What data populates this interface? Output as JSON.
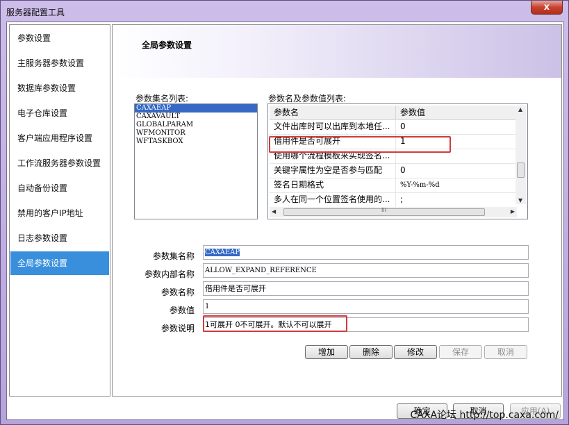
{
  "window": {
    "title": "服务器配置工具",
    "close_symbol": "x"
  },
  "nav": {
    "items": [
      {
        "label": "参数设置"
      },
      {
        "label": "主服务器参数设置"
      },
      {
        "label": "数据库参数设置"
      },
      {
        "label": "电子仓库设置"
      },
      {
        "label": "客户端应用程序设置"
      },
      {
        "label": "工作流服务器参数设置"
      },
      {
        "label": "自动备份设置"
      },
      {
        "label": "禁用的客户IP地址"
      },
      {
        "label": "日志参数设置"
      },
      {
        "label": "全局参数设置"
      }
    ],
    "active_index": 9
  },
  "main": {
    "header_title": "全局参数设置",
    "set_list_label": "参数集名列表:",
    "set_list": [
      "CAXAEAP",
      "CAXAVAULT",
      "GLOBALPARAM",
      "WFMONITOR",
      "WFTASKBOX"
    ],
    "param_list_label": "参数名及参数值列表:",
    "grid": {
      "col_name": "参数名",
      "col_value": "参数值",
      "rows": [
        {
          "name": "文件出库时可以出库到本地任...",
          "value": "0"
        },
        {
          "name": "借用件是否可展开",
          "value": "1"
        },
        {
          "name": "使用哪个流程模板来实现签名...",
          "value": ""
        },
        {
          "name": "关键字属性为空是否参与匹配",
          "value": "0"
        },
        {
          "name": "签名日期格式",
          "value": "%Y-%m-%d"
        },
        {
          "name": "多人在同一个位置签名使用的...",
          "value": ";"
        }
      ],
      "scroll_h_grip": "III"
    },
    "form": {
      "set_name_label": "参数集名称",
      "set_name_value": "CAXAEAP",
      "internal_name_label": "参数内部名称",
      "internal_name_value": "ALLOW_EXPAND_REFERENCE",
      "param_name_label": "参数名称",
      "param_name_value": "借用件是否可展开",
      "param_value_label": "参数值",
      "param_value_value": "1",
      "desc_label": "参数说明",
      "desc_value": "1可展开 0不可展开。默认不可以展开"
    },
    "buttons": {
      "add": "增加",
      "delete": "删除",
      "modify": "修改",
      "save": "保存",
      "cancel": "取消"
    }
  },
  "footer": {
    "ok": "确定",
    "cancel": "取消",
    "apply": "应用(A)"
  },
  "watermark": "CAXA论坛 http://top.caxa.com/"
}
